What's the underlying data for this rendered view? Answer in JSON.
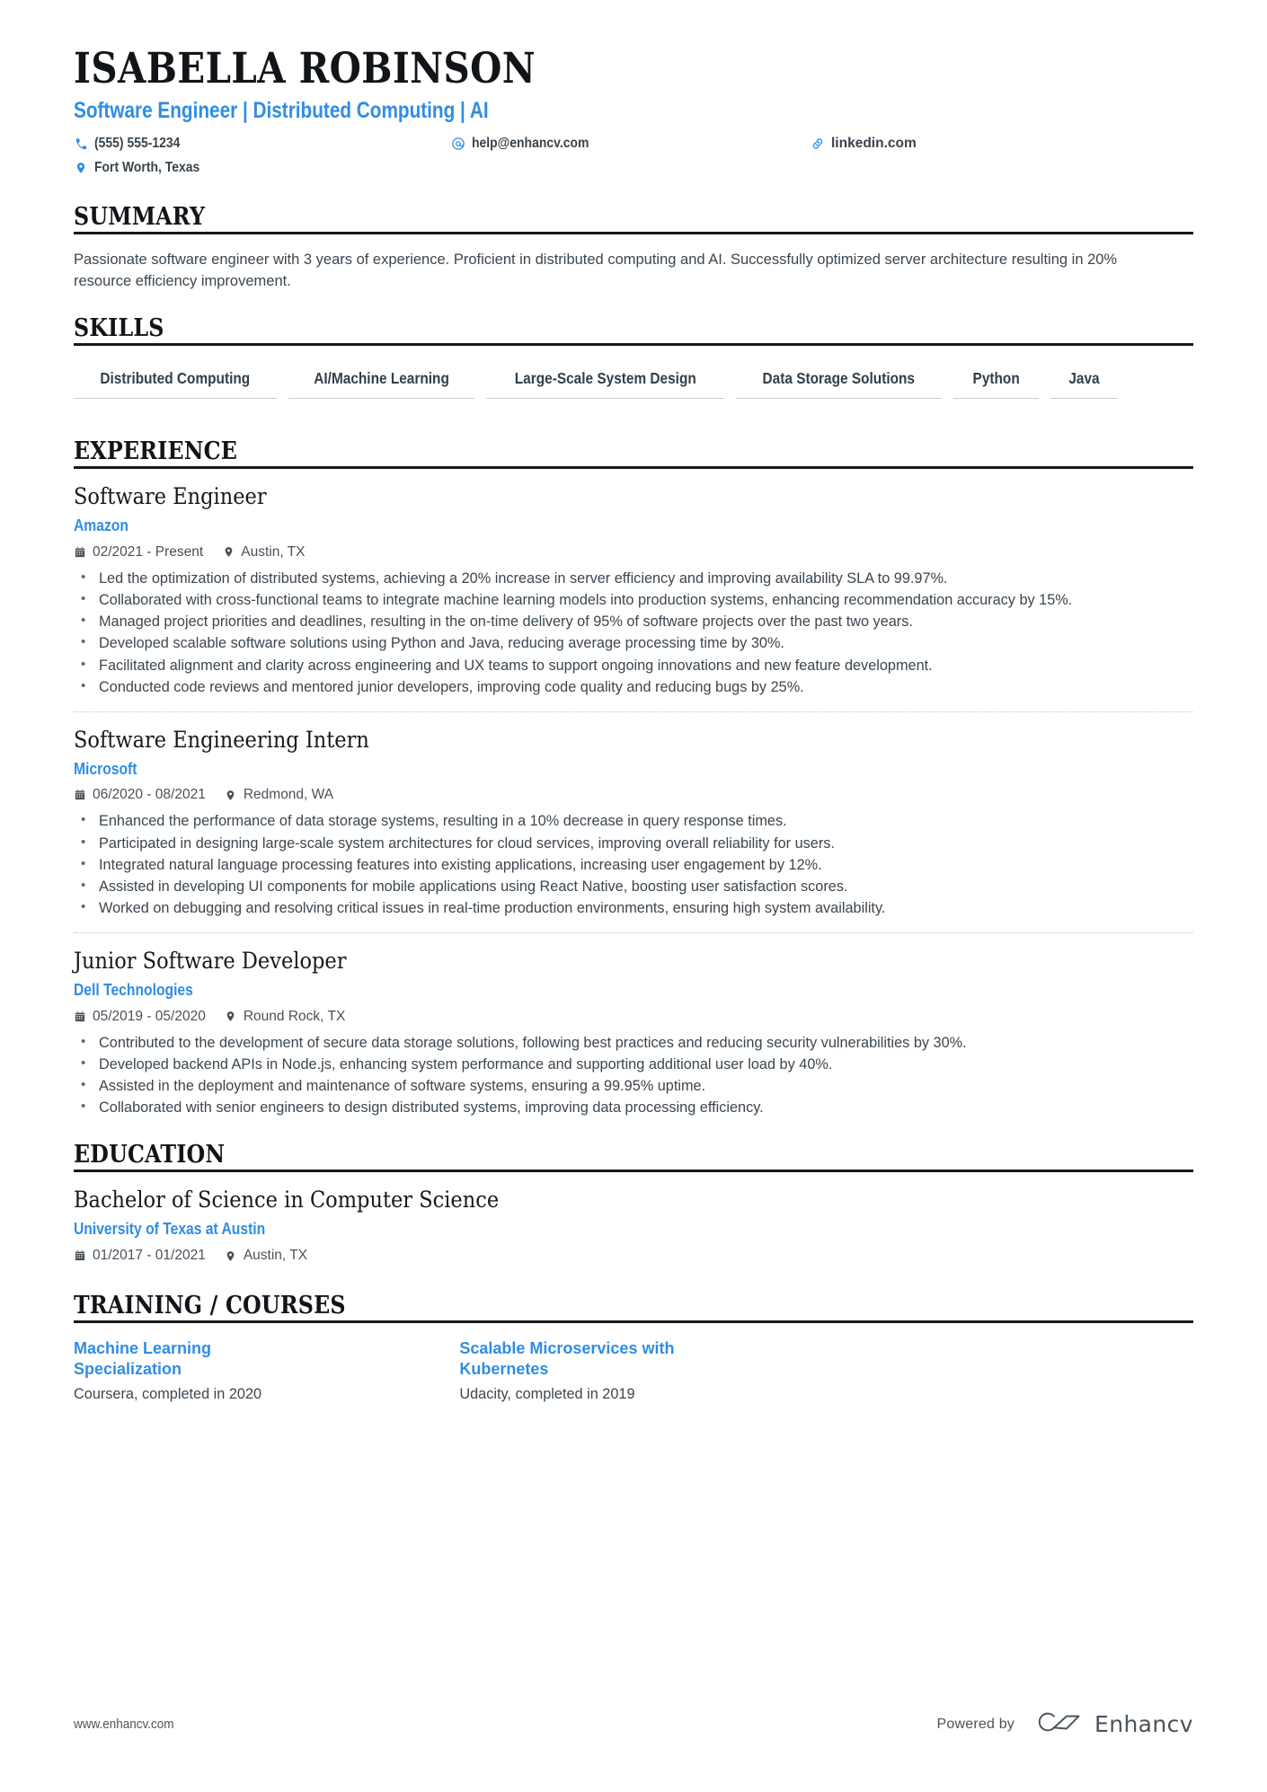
{
  "header": {
    "name": "ISABELLA ROBINSON",
    "subtitle": "Software Engineer | Distributed Computing | AI",
    "contacts": [
      {
        "icon": "phone-icon",
        "text": "(555) 555-1234"
      },
      {
        "icon": "email-icon",
        "text": "help@enhancv.com"
      },
      {
        "icon": "link-icon",
        "text": "linkedin.com"
      },
      {
        "icon": "location-icon",
        "text": "Fort Worth, Texas"
      }
    ]
  },
  "summary": {
    "title": "SUMMARY",
    "text": "Passionate software engineer with 3 years of experience. Proficient in distributed computing and AI. Successfully optimized server architecture resulting in 20% resource efficiency improvement."
  },
  "skills": {
    "title": "SKILLS",
    "items": [
      "Distributed Computing",
      "AI/Machine Learning",
      "Large-Scale System Design",
      "Data Storage Solutions",
      "Python",
      "Java"
    ]
  },
  "experience": {
    "title": "EXPERIENCE",
    "entries": [
      {
        "role": "Software Engineer",
        "company": "Amazon",
        "dates": "02/2021 - Present",
        "location": "Austin, TX",
        "bullets": [
          "Led the optimization of distributed systems, achieving a 20% increase in server efficiency and improving availability SLA to 99.97%.",
          "Collaborated with cross-functional teams to integrate machine learning models into production systems, enhancing recommendation accuracy by 15%.",
          "Managed project priorities and deadlines, resulting in the on-time delivery of 95% of software projects over the past two years.",
          "Developed scalable software solutions using Python and Java, reducing average processing time by 30%.",
          "Facilitated alignment and clarity across engineering and UX teams to support ongoing innovations and new feature development.",
          "Conducted code reviews and mentored junior developers, improving code quality and reducing bugs by 25%."
        ]
      },
      {
        "role": "Software Engineering Intern",
        "company": "Microsoft",
        "dates": "06/2020 - 08/2021",
        "location": "Redmond, WA",
        "bullets": [
          "Enhanced the performance of data storage systems, resulting in a 10% decrease in query response times.",
          "Participated in designing large-scale system architectures for cloud services, improving overall reliability for users.",
          "Integrated natural language processing features into existing applications, increasing user engagement by 12%.",
          "Assisted in developing UI components for mobile applications using React Native, boosting user satisfaction scores.",
          "Worked on debugging and resolving critical issues in real-time production environments, ensuring high system availability."
        ]
      },
      {
        "role": "Junior Software Developer",
        "company": "Dell Technologies",
        "dates": "05/2019 - 05/2020",
        "location": "Round Rock, TX",
        "bullets": [
          "Contributed to the development of secure data storage solutions, following best practices and reducing security vulnerabilities by 30%.",
          "Developed backend APIs in Node.js, enhancing system performance and supporting additional user load by 40%.",
          "Assisted in the deployment and maintenance of software systems, ensuring a 99.95% uptime.",
          "Collaborated with senior engineers to design distributed systems, improving data processing efficiency."
        ]
      }
    ]
  },
  "education": {
    "title": "EDUCATION",
    "entries": [
      {
        "degree": "Bachelor of Science in Computer Science",
        "school": "University of Texas at Austin",
        "dates": "01/2017 - 01/2021",
        "location": "Austin, TX"
      }
    ]
  },
  "training": {
    "title": "TRAINING / COURSES",
    "courses": [
      {
        "name": "Machine Learning Specialization",
        "detail": "Coursera, completed in 2020"
      },
      {
        "name": "Scalable Microservices with Kubernetes",
        "detail": "Udacity, completed in 2019"
      }
    ]
  },
  "footer": {
    "website": "www.enhancv.com",
    "powered_by": "Powered by",
    "brand": "Enhancv"
  },
  "colors": {
    "accent": "#2f8de4",
    "text": "#3c464f",
    "heading": "#15191d",
    "rule": "#15191d"
  }
}
